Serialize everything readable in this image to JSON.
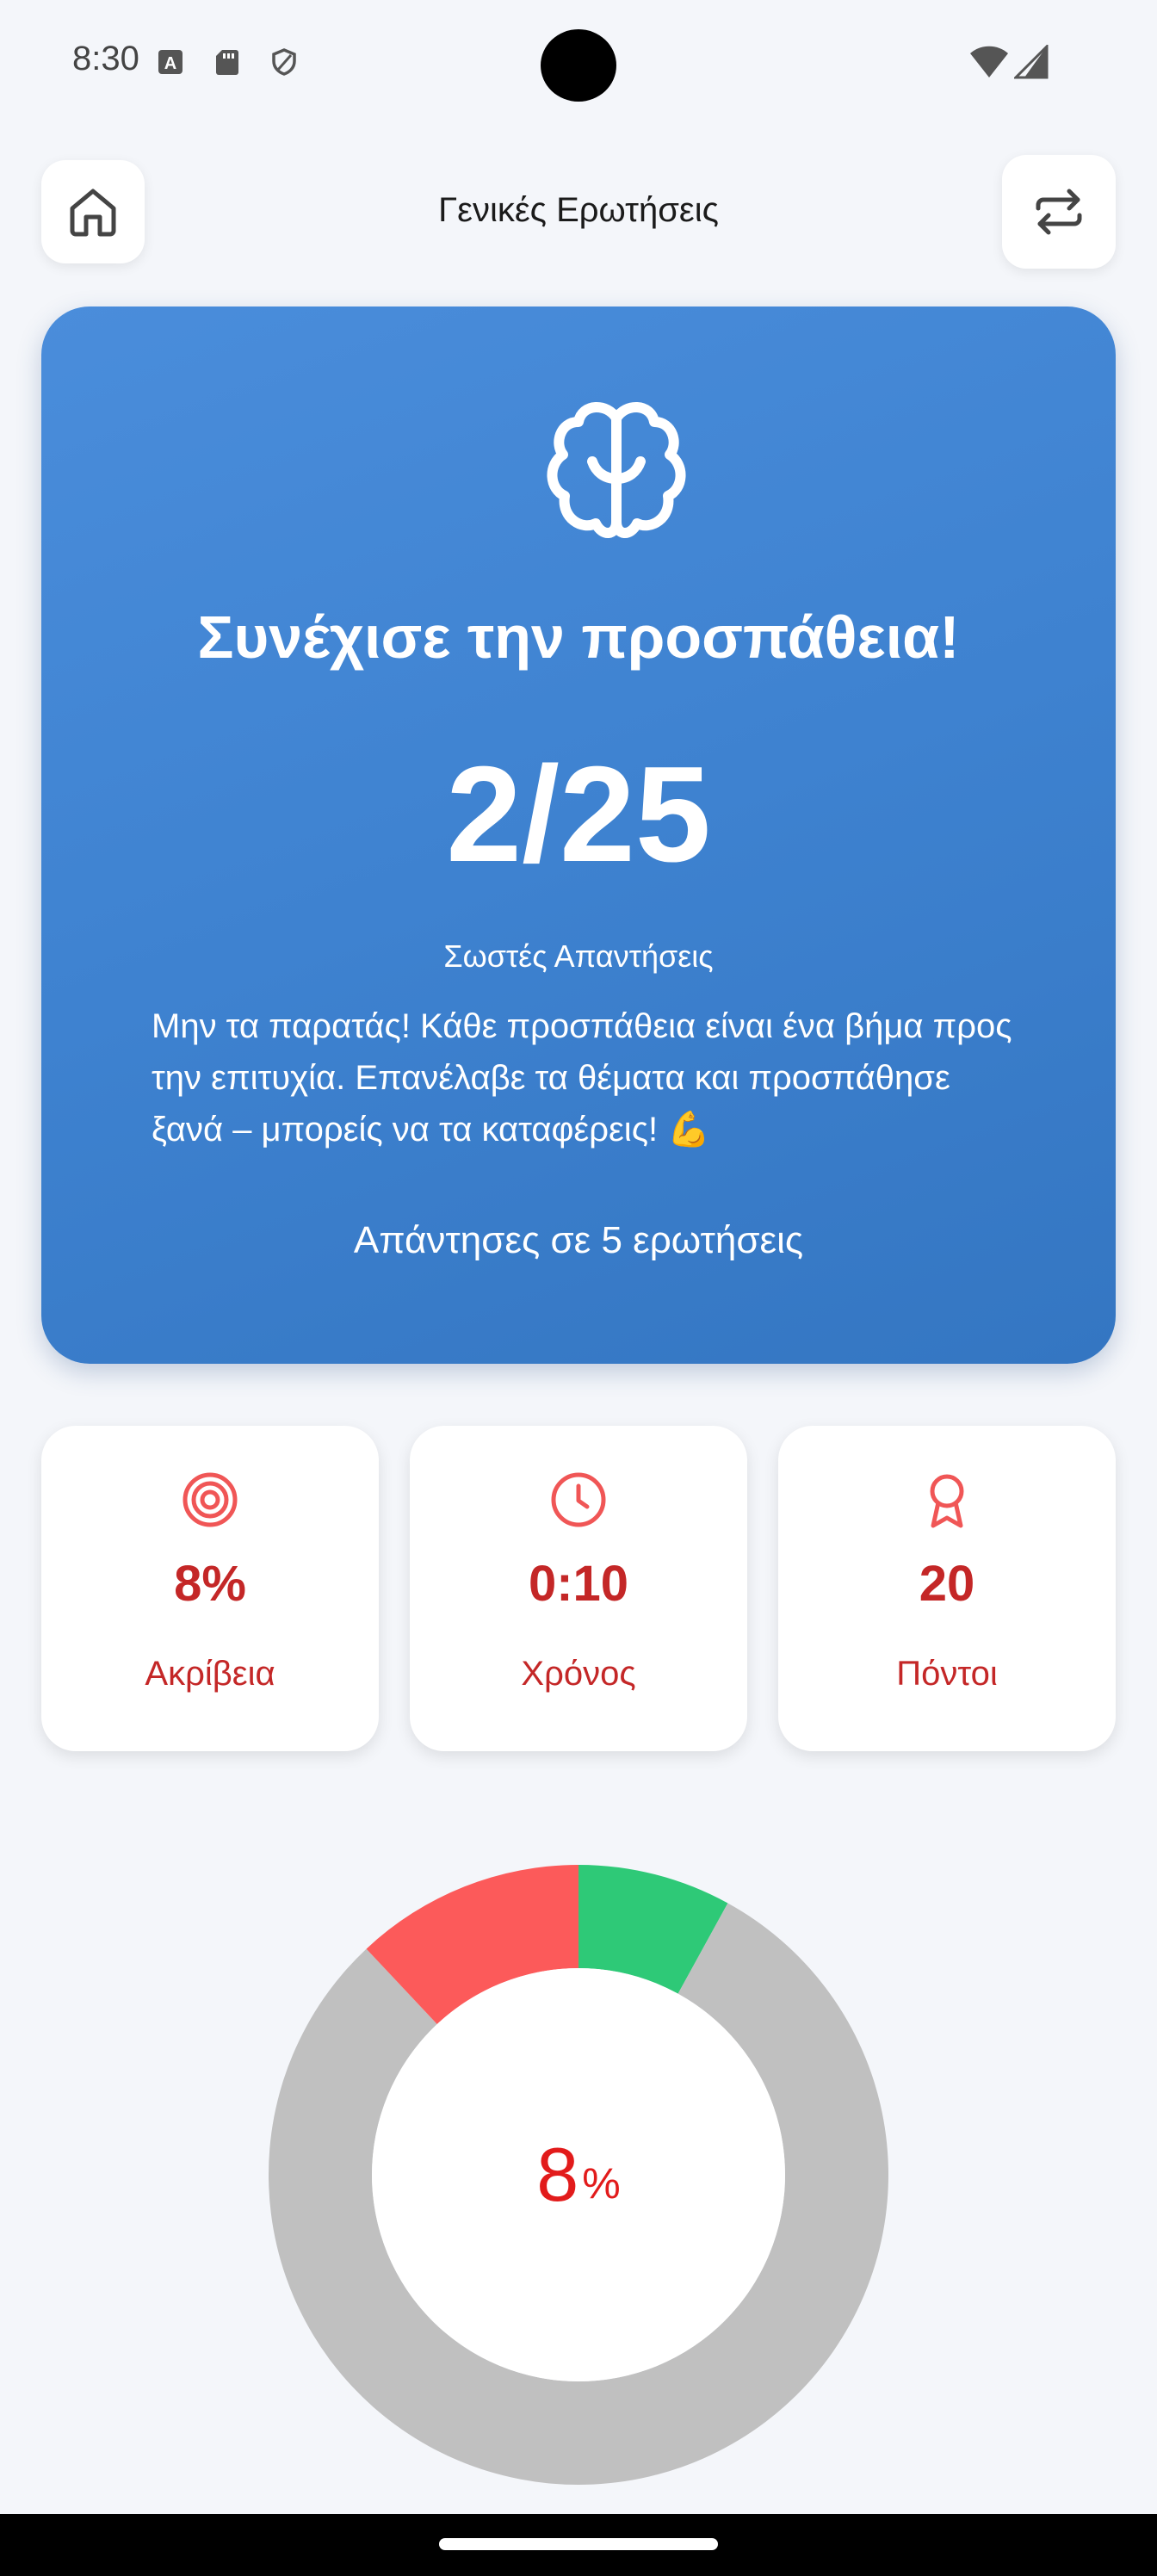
{
  "status_bar": {
    "time": "8:30",
    "icons": [
      "a-notification-icon",
      "sd-card-icon",
      "shield-icon",
      "wifi-icon",
      "cellular-icon"
    ]
  },
  "nav": {
    "title": "Γενικές Ερωτήσεις",
    "home_icon": "home-icon",
    "swap_icon": "repeat-arrows-icon"
  },
  "hero": {
    "icon": "brain-icon",
    "title": "Συνέχισε την προσπάθεια!",
    "score": "2/25",
    "score_label": "Σωστές Απαντήσεις",
    "message": "Μην τα παρατάς! Κάθε προσπάθεια είναι ένα βήμα προς την επιτυχία. Επανέλαβε τα θέματα και προσπάθησε ξανά – μπορείς να τα καταφέρεις! 💪",
    "footer": "Απάντησες σε 5 ερωτήσεις",
    "gradient_start": "#4a8ddb",
    "gradient_end": "#3476c2"
  },
  "stats": [
    {
      "icon": "target-icon",
      "value": "8%",
      "label": "Ακρίβεια"
    },
    {
      "icon": "clock-icon",
      "value": "0:10",
      "label": "Χρόνος"
    },
    {
      "icon": "award-ribbon-icon",
      "value": "20",
      "label": "Πόντοι"
    }
  ],
  "donut": {
    "value": "8",
    "unit": "%",
    "segments": [
      {
        "name": "correct",
        "fraction": 0.08,
        "color": "#2ec977"
      },
      {
        "name": "unanswered",
        "fraction": 0.8,
        "color": "#c0c0c0"
      },
      {
        "name": "wrong",
        "fraction": 0.12,
        "color": "#fc5a5a"
      }
    ]
  },
  "colors": {
    "accent_red": "#c42727",
    "background": "#f4f6fa"
  }
}
